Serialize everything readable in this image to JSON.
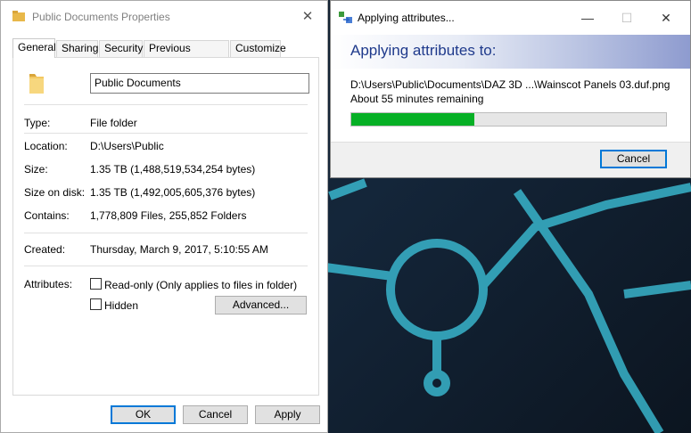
{
  "properties_window": {
    "title": "Public Documents Properties",
    "close_glyph": "✕",
    "tabs": [
      "General",
      "Sharing",
      "Security",
      "Previous Versions",
      "Customize"
    ],
    "folder_name": "Public Documents",
    "rows": {
      "type_label": "Type:",
      "type_value": "File folder",
      "location_label": "Location:",
      "location_value": "D:\\Users\\Public",
      "size_label": "Size:",
      "size_value": "1.35 TB (1,488,519,534,254 bytes)",
      "size_on_disk_label": "Size on disk:",
      "size_on_disk_value": "1.35 TB (1,492,005,605,376 bytes)",
      "contains_label": "Contains:",
      "contains_value": "1,778,809 Files, 255,852 Folders",
      "created_label": "Created:",
      "created_value": "Thursday, March 9, 2017, 5:10:55 AM",
      "attributes_label": "Attributes:"
    },
    "attributes": {
      "readonly_label": "Read-only (Only applies to files in folder)",
      "readonly_checked": false,
      "hidden_label": "Hidden",
      "hidden_checked": false,
      "advanced_label": "Advanced..."
    },
    "buttons": {
      "ok": "OK",
      "cancel": "Cancel",
      "apply": "Apply"
    }
  },
  "apply_window": {
    "title": "Applying attributes...",
    "minimize_glyph": "—",
    "maximize_glyph": "☐",
    "close_glyph": "✕",
    "heading": "Applying attributes to:",
    "path": "D:\\Users\\Public\\Documents\\DAZ 3D ...\\Wainscot Panels 03.duf.png",
    "time_remaining": "About 55 minutes remaining",
    "progress_percent": 39,
    "progress_color": "#06b025",
    "cancel_label": "Cancel"
  },
  "colors": {
    "accent": "#0078d7",
    "heading_blue": "#1f3a8c"
  }
}
